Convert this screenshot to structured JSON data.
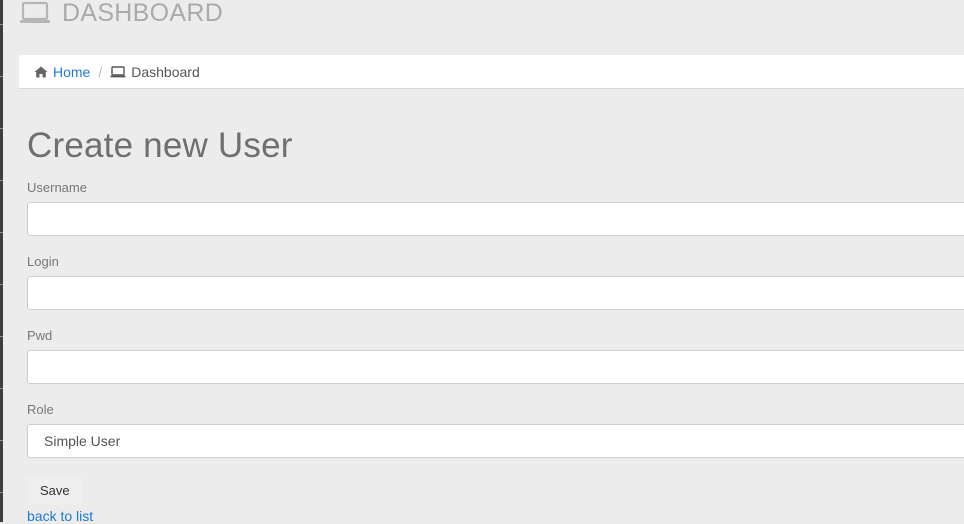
{
  "page_header": {
    "icon": "laptop-icon",
    "title": "DASHBOARD"
  },
  "breadcrumb": {
    "home_icon": "home-icon",
    "home_label": "Home",
    "separator": "/",
    "current_icon": "laptop-icon",
    "current_label": "Dashboard"
  },
  "form": {
    "title": "Create new User",
    "fields": {
      "username": {
        "label": "Username",
        "value": "",
        "placeholder": ""
      },
      "login": {
        "label": "Login",
        "value": "",
        "placeholder": ""
      },
      "pwd": {
        "label": "Pwd",
        "value": "",
        "placeholder": ""
      },
      "role": {
        "label": "Role",
        "selected": "Simple User"
      }
    },
    "save_label": "Save",
    "back_link_label": "back to list"
  },
  "colors": {
    "background": "#ececec",
    "link": "#1f7ad6",
    "header_text": "#aaaaaa",
    "sidebar_strip": "#3a3f44"
  }
}
